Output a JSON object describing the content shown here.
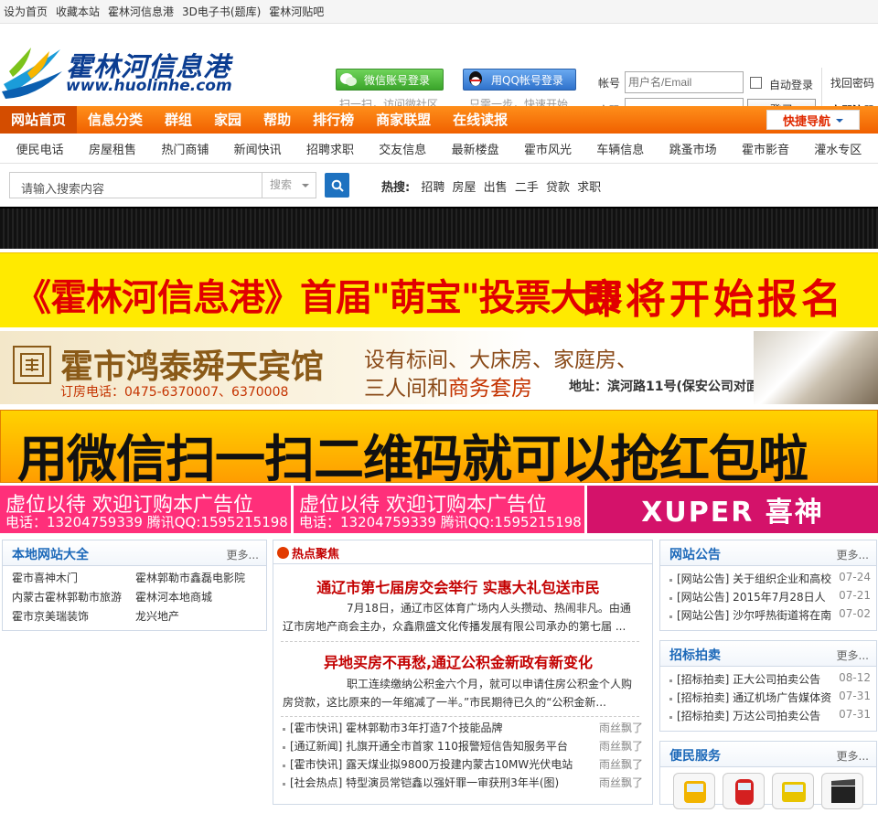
{
  "topbar": {
    "items": [
      "设为首页",
      "收藏本站",
      "霍林河信息港",
      "3D电子书(题库)",
      "霍林河贴吧"
    ]
  },
  "logo": {
    "title": "霍林河信息港",
    "url": "www.huolinhe.com"
  },
  "login": {
    "wechat_label": "微信账号登录",
    "wechat_hint": "扫一扫，访问微社区",
    "qq_label": "用QQ帐号登录",
    "qq_hint": "只需一步，快速开始",
    "account_label": "帐号",
    "account_placeholder": "用户名/Email",
    "password_label": "密码",
    "auto_login": "自动登录",
    "submit": "登录",
    "forgot": "找回密码",
    "register": "立即注册"
  },
  "nav": {
    "items": [
      "网站首页",
      "信息分类",
      "群组",
      "家园",
      "帮助",
      "排行榜",
      "商家联盟",
      "在线读报"
    ],
    "quick": "快捷导航"
  },
  "subnav": {
    "items": [
      "便民电话",
      "房屋租售",
      "热门商铺",
      "新闻快讯",
      "招聘求职",
      "交友信息",
      "最新楼盘",
      "霍市风光",
      "车辆信息",
      "跳蚤市场",
      "霍市影音",
      "灌水专区"
    ]
  },
  "search": {
    "placeholder": "请输入搜索内容",
    "type": "搜索",
    "hot_label": "热搜:",
    "hot_items": [
      "招聘",
      "房屋",
      "出售",
      "二手",
      "贷款",
      "求职"
    ]
  },
  "banners": {
    "vote_left": "《霍林河信息港》首届\"萌宝\"投票大赛",
    "vote_right": "即将开始报名啦",
    "hotel_name": "霍市鸿泰舜天宾馆",
    "hotel_tel": "订房电话：0475-6370007、6370008",
    "hotel_line1": "设有标间、大床房、家庭房、",
    "hotel_line2a": "三人间和",
    "hotel_line2b": "商务套房",
    "hotel_addr": "地址：滨河路11号(保安公司对面)",
    "wechat_red": "用微信扫一扫二维码就可以抢红包啦",
    "ad_line1": "虚位以待  欢迎订购本广告位",
    "ad_line2": "电话：13204759339  腾讯QQ:1595215198",
    "xuper": "XUPER 喜神"
  },
  "local_sites": {
    "title": "本地网站大全",
    "more": "更多...",
    "items": [
      "霍市喜神木门",
      "霍林郭勒市鑫磊电影院",
      "内蒙古霍林郭勒市旅游",
      "霍林河本地商城",
      "霍市京美瑞装饰",
      "龙兴地产"
    ]
  },
  "hot_news": {
    "title": "热点聚焦",
    "h1": "通辽市第七届房交会举行  实惠大礼包送市民",
    "t1": "7月18日，通辽市区体育广场内人头攒动、热闹非凡。由通辽市房地产商会主办，众鑫鼎盛文化传播发展有限公司承办的第七届 ...",
    "h2": "异地买房不再愁,通辽公积金新政有新变化",
    "t2": "职工连续缴纳公积金六个月，就可以申请住房公积金个人购房贷款，这比原来的一年缩减了一半。”市民期待已久的“公积金新...",
    "list": [
      {
        "text": "[霍市快讯] 霍林郭勒市3年打造7个技能品牌",
        "who": "雨丝飘了"
      },
      {
        "text": "[通辽新闻] 扎旗开通全市首家 110报警短信告知服务平台",
        "who": "雨丝飘了"
      },
      {
        "text": "[霍市快讯] 露天煤业拟9800万投建内蒙古10MW光伏电站",
        "who": "雨丝飘了"
      },
      {
        "text": "[社会热点] 特型演员常铠鑫以强奸罪一审获刑3年半(图)",
        "who": "雨丝飘了"
      }
    ]
  },
  "announce": {
    "title": "网站公告",
    "more": "更多...",
    "items": [
      {
        "text": "[网站公告] 关于组织企业和高校",
        "date": "07-24"
      },
      {
        "text": "[网站公告] 2015年7月28日人",
        "date": "07-21"
      },
      {
        "text": "[网站公告] 沙尔呼热街道将在南",
        "date": "07-02"
      }
    ]
  },
  "auction": {
    "title": "招标拍卖",
    "more": "更多...",
    "items": [
      {
        "text": "[招标拍卖] 正大公司拍卖公告",
        "date": "08-12"
      },
      {
        "text": "[招标拍卖] 通辽机场广告媒体资",
        "date": "07-31"
      },
      {
        "text": "[招标拍卖] 万达公司拍卖公告",
        "date": "07-31"
      }
    ]
  },
  "service": {
    "title": "便民服务",
    "more": "更多..."
  }
}
